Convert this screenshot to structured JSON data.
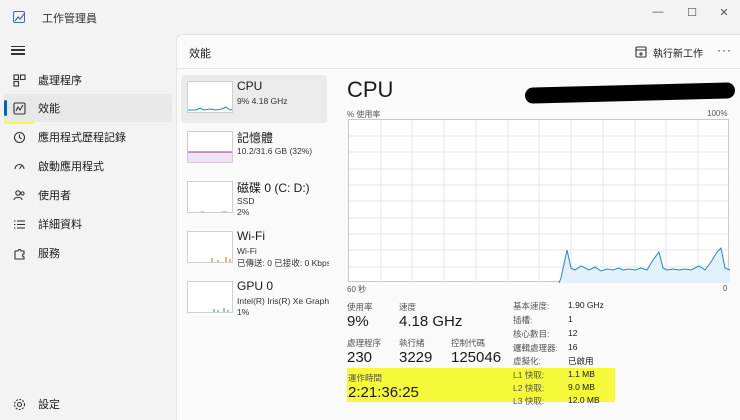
{
  "app": {
    "title": "工作管理員"
  },
  "window_controls": {
    "minimize": "—",
    "maximize": "☐",
    "close": "✕"
  },
  "sidebar": {
    "items": [
      {
        "label": "處理程序",
        "icon": "processes-grid-icon"
      },
      {
        "label": "效能",
        "icon": "performance-chart-icon",
        "active": true
      },
      {
        "label": "應用程式歷程記錄",
        "icon": "history-icon"
      },
      {
        "label": "啟動應用程式",
        "icon": "startup-gauge-icon"
      },
      {
        "label": "使用者",
        "icon": "users-icon"
      },
      {
        "label": "詳細資料",
        "icon": "details-list-icon"
      },
      {
        "label": "服務",
        "icon": "services-puzzle-icon"
      }
    ],
    "settings_label": "設定"
  },
  "header": {
    "title": "效能",
    "run_task_label": "執行新工作",
    "more": "···"
  },
  "devices": [
    {
      "name": "CPU",
      "sub1": "9%  4.18 GHz",
      "sub2": "",
      "sub3": ""
    },
    {
      "name": "記憶體",
      "sub1": "10.2/31.6 GB (32%)",
      "sub2": "",
      "sub3": ""
    },
    {
      "name": "磁碟 0 (C: D:)",
      "sub1": "SSD",
      "sub2": "2%",
      "sub3": ""
    },
    {
      "name": "Wi-Fi",
      "sub1": "Wi-Fi",
      "sub2": "已傳送: 0 已接收: 0 Kbps",
      "sub3": ""
    },
    {
      "name": "GPU 0",
      "sub1": "Intel(R) Iris(R) Xe Graphics",
      "sub2": "1%",
      "sub3": ""
    }
  ],
  "detail": {
    "title": "CPU",
    "graph_label_left": "% 使用率",
    "graph_label_right": "100%",
    "graph_bottom_left": "60 秒",
    "graph_bottom_right": "0",
    "utilization": {
      "label": "使用率",
      "value": "9%"
    },
    "speed": {
      "label": "速度",
      "value": "4.18 GHz"
    },
    "processes": {
      "label": "處理程序",
      "value": "230"
    },
    "threads": {
      "label": "執行緒",
      "value": "3229"
    },
    "handles": {
      "label": "控制代碼",
      "value": "125046"
    },
    "uptime": {
      "label": "運作時間",
      "value": "2:21:36:25"
    },
    "specs": [
      {
        "key": "基本速度:",
        "value": "1.90 GHz"
      },
      {
        "key": "插槽:",
        "value": "1"
      },
      {
        "key": "核心數目:",
        "value": "12"
      },
      {
        "key": "邏輯處理器:",
        "value": "16"
      },
      {
        "key": "虛擬化:",
        "value": "已啟用"
      },
      {
        "key": "L1 快取:",
        "value": "1.1 MB"
      },
      {
        "key": "L2 快取:",
        "value": "9.0 MB"
      },
      {
        "key": "L3 快取:",
        "value": "12.0 MB"
      }
    ]
  },
  "colors": {
    "accent": "#0067c0",
    "cpu_line": "#1f88c9",
    "mem_line": "#8b3aa3",
    "disk_line": "#3a9b3a",
    "wifi_line": "#c27a1f",
    "highlight": "#f6f83a"
  }
}
